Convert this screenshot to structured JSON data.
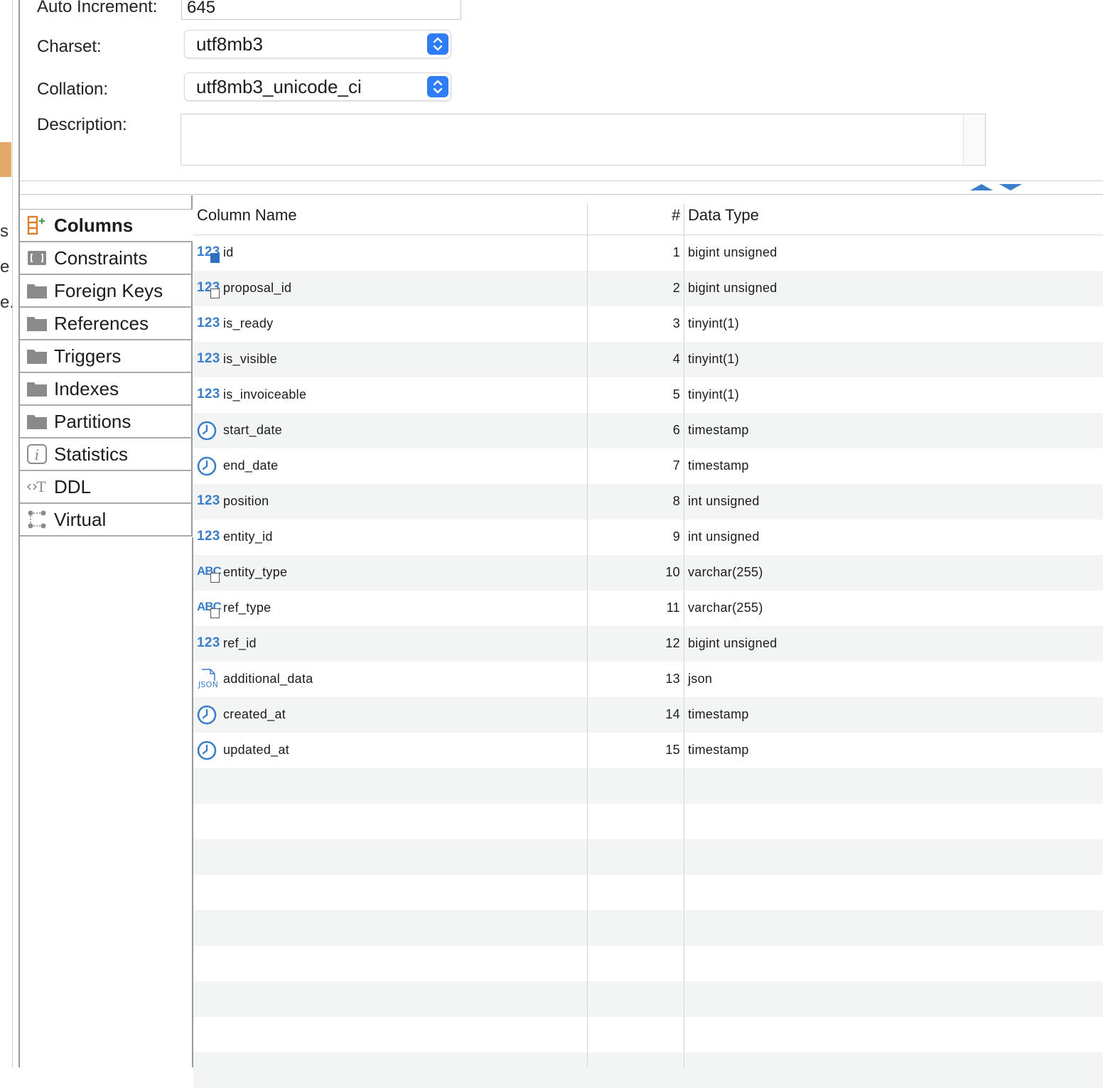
{
  "form": {
    "auto_increment_label": "Auto Increment:",
    "auto_increment_value": "645",
    "charset_label": "Charset:",
    "charset_value": "utf8mb3",
    "collation_label": "Collation:",
    "collation_value": "utf8mb3_unicode_ci",
    "description_label": "Description:",
    "description_value": ""
  },
  "edge_fragments": [
    "s",
    "e",
    "e."
  ],
  "tabs": [
    {
      "label": "Columns",
      "icon": "columns-icon",
      "active": true
    },
    {
      "label": "Constraints",
      "icon": "constraints-icon"
    },
    {
      "label": "Foreign Keys",
      "icon": "folder-icon"
    },
    {
      "label": "References",
      "icon": "folder-icon"
    },
    {
      "label": "Triggers",
      "icon": "folder-icon"
    },
    {
      "label": "Indexes",
      "icon": "folder-icon"
    },
    {
      "label": "Partitions",
      "icon": "folder-icon"
    },
    {
      "label": "Statistics",
      "icon": "info-icon"
    },
    {
      "label": "DDL",
      "icon": "ddl-icon"
    },
    {
      "label": "Virtual",
      "icon": "virtual-icon"
    }
  ],
  "grid": {
    "headers": {
      "name": "Column Name",
      "num": "#",
      "type": "Data Type"
    },
    "rows": [
      {
        "icon": "numeric-key-icon",
        "name": "id",
        "num": "1",
        "type": "bigint unsigned"
      },
      {
        "icon": "numeric-fk-icon",
        "name": "proposal_id",
        "num": "2",
        "type": "bigint unsigned"
      },
      {
        "icon": "numeric-icon",
        "name": "is_ready",
        "num": "3",
        "type": "tinyint(1)"
      },
      {
        "icon": "numeric-icon",
        "name": "is_visible",
        "num": "4",
        "type": "tinyint(1)"
      },
      {
        "icon": "numeric-icon",
        "name": "is_invoiceable",
        "num": "5",
        "type": "tinyint(1)"
      },
      {
        "icon": "clock-icon",
        "name": "start_date",
        "num": "6",
        "type": "timestamp"
      },
      {
        "icon": "clock-icon",
        "name": "end_date",
        "num": "7",
        "type": "timestamp"
      },
      {
        "icon": "numeric-icon",
        "name": "position",
        "num": "8",
        "type": "int unsigned"
      },
      {
        "icon": "numeric-icon",
        "name": "entity_id",
        "num": "9",
        "type": "int unsigned"
      },
      {
        "icon": "string-fk-icon",
        "name": "entity_type",
        "num": "10",
        "type": "varchar(255)"
      },
      {
        "icon": "string-fk-icon",
        "name": "ref_type",
        "num": "11",
        "type": "varchar(255)"
      },
      {
        "icon": "numeric-icon",
        "name": "ref_id",
        "num": "12",
        "type": "bigint unsigned"
      },
      {
        "icon": "json-icon",
        "name": "additional_data",
        "num": "13",
        "type": "json"
      },
      {
        "icon": "clock-icon",
        "name": "created_at",
        "num": "14",
        "type": "timestamp"
      },
      {
        "icon": "clock-icon",
        "name": "updated_at",
        "num": "15",
        "type": "timestamp"
      }
    ]
  },
  "colors": {
    "accent": "#2f7cf6",
    "icon_blue": "#3a7ec9",
    "row_alt": "#f3f4f4",
    "edge_accent": "#e4a86a"
  }
}
